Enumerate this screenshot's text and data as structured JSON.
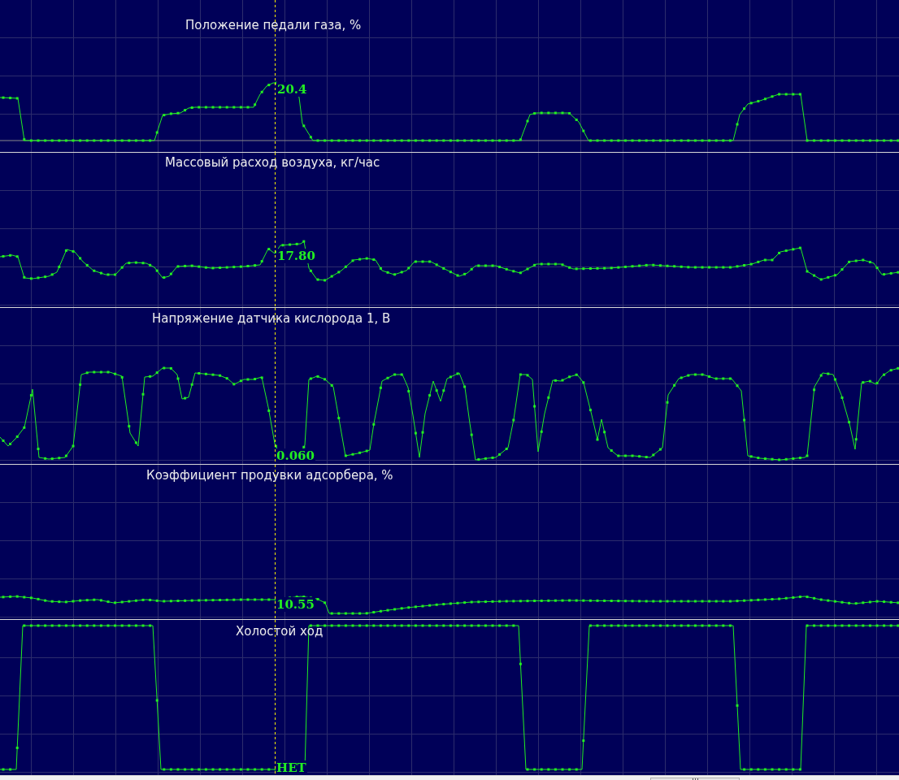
{
  "panels": [
    {
      "title": "Положение педали газа, %",
      "reading": "20.4"
    },
    {
      "title": "Массовый расход воздуха, кг/час",
      "reading": "17.80"
    },
    {
      "title": "Напряжение датчика кислорода 1, В",
      "reading": "0.060"
    },
    {
      "title": "Коэффициент продувки адсорбера, %",
      "reading": "10.55"
    },
    {
      "title": "Холостой ход",
      "reading": "НЕТ"
    }
  ]
}
